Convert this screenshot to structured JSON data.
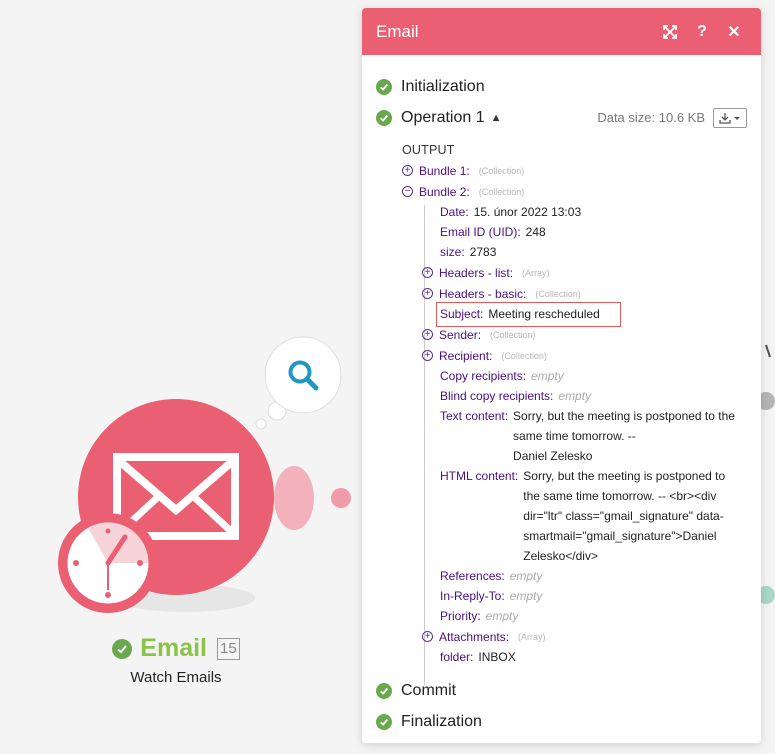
{
  "module": {
    "title": "Email",
    "badge": "15",
    "subtitle": "Watch Emails"
  },
  "panel": {
    "title": "Email",
    "steps": {
      "initialization": "Initialization",
      "operation": "Operation 1",
      "commit": "Commit",
      "finalization": "Finalization"
    },
    "data_size": "Data size: 10.6 KB",
    "output_label": "OUTPUT",
    "bundles": [
      {
        "key": "Bundle 1:",
        "type": "(Collection)"
      },
      {
        "key": "Bundle 2:",
        "type": "(Collection)"
      }
    ],
    "fields": {
      "date_key": "Date:",
      "date_val": "15. únor 2022 13:03",
      "email_id_key": "Email ID (UID):",
      "email_id_val": "248",
      "size_key": "size:",
      "size_val": "2783",
      "headers_list_key": "Headers - list:",
      "headers_list_type": "(Array)",
      "headers_basic_key": "Headers - basic:",
      "headers_basic_type": "(Collection)",
      "subject_key": "Subject:",
      "subject_val": "Meeting rescheduled",
      "sender_key": "Sender:",
      "sender_type": "(Collection)",
      "recipient_key": "Recipient:",
      "recipient_type": "(Collection)",
      "copy_key": "Copy recipients:",
      "copy_val": "empty",
      "blind_key": "Blind copy recipients:",
      "blind_val": "empty",
      "text_key": "Text content:",
      "text_val_1": "Sorry, but the meeting is postponed to the",
      "text_val_2": "same time tomorrow. --",
      "text_val_3": "Daniel Zelesko",
      "html_key": "HTML content:",
      "html_val_1": "Sorry, but the meeting is postponed to",
      "html_val_2": "the same time tomorrow. -- <br><div",
      "html_val_3": "dir=\"ltr\" class=\"gmail_signature\" data-",
      "html_val_4": "smartmail=\"gmail_signature\">Daniel",
      "html_val_5": "Zelesko</div>",
      "references_key": "References:",
      "references_val": "empty",
      "reply_key": "In-Reply-To:",
      "reply_val": "empty",
      "priority_key": "Priority:",
      "priority_val": "empty",
      "attachments_key": "Attachments:",
      "attachments_type": "(Array)",
      "folder_key": "folder:",
      "folder_val": "INBOX"
    }
  },
  "colors": {
    "accent": "#ea5f72",
    "success": "#6aa84f",
    "key": "#4b0f82",
    "highlight": "#e05a5a"
  }
}
